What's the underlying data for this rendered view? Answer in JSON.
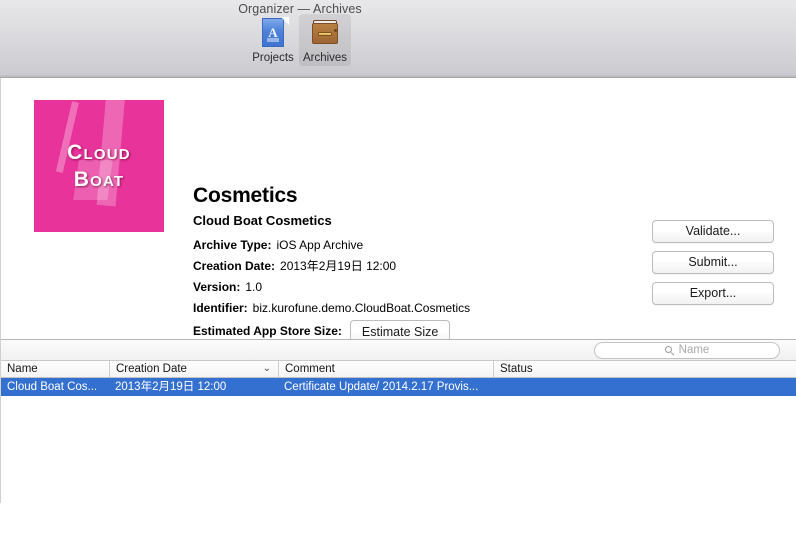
{
  "window": {
    "title": "Organizer — Archives"
  },
  "toolbar": {
    "tabs": [
      {
        "label": "Projects",
        "icon": "app-store-document-icon",
        "selected": false
      },
      {
        "label": "Archives",
        "icon": "file-cabinet-icon",
        "selected": true
      }
    ]
  },
  "app_icon": {
    "line1": "Cloud",
    "line2": "Boat",
    "background_color": "#e8339a"
  },
  "detail": {
    "title": "Cosmetics",
    "subtitle": "Cloud Boat Cosmetics",
    "fields": [
      {
        "key": "Archive Type:",
        "value": "iOS App Archive"
      },
      {
        "key": "Creation Date:",
        "value": "2013年2月19日 12:00"
      },
      {
        "key": "Version:",
        "value": "1.0"
      },
      {
        "key": "Identifier:",
        "value": "biz.kurofune.demo.CloudBoat.Cosmetics"
      }
    ],
    "estimated_size_label": "Estimated App Store Size:",
    "estimate_button": "Estimate Size"
  },
  "actions": {
    "validate": "Validate...",
    "submit": "Submit...",
    "export": "Export..."
  },
  "search": {
    "placeholder": "Name",
    "value": "",
    "icon": "search-icon"
  },
  "table": {
    "columns": [
      {
        "label": "Name",
        "sort": "none"
      },
      {
        "label": "Creation Date",
        "sort": "descending"
      },
      {
        "label": "Comment",
        "sort": "none"
      },
      {
        "label": "Status",
        "sort": "none"
      }
    ],
    "rows": [
      {
        "selected": true,
        "name": "Cloud Boat Cos...",
        "creation_date": "2013年2月19日 12:00",
        "comment": "Certificate Update/ 2014.2.17 Provis...",
        "status": ""
      }
    ]
  },
  "colors": {
    "selection_blue": "#3470d0",
    "icon_pink": "#e8339a"
  }
}
